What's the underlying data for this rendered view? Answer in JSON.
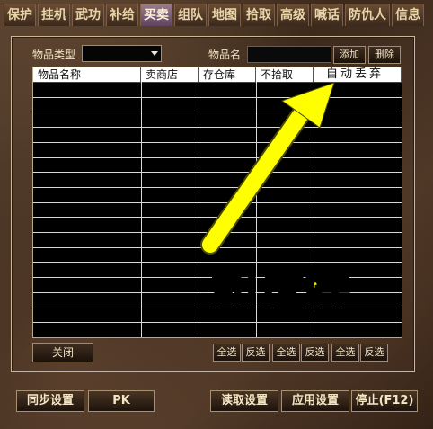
{
  "tabs": [
    {
      "label": "保护"
    },
    {
      "label": "挂机"
    },
    {
      "label": "武功"
    },
    {
      "label": "补给"
    },
    {
      "label": "买卖"
    },
    {
      "label": "组队"
    },
    {
      "label": "地图"
    },
    {
      "label": "拾取"
    },
    {
      "label": "高级"
    },
    {
      "label": "喊话"
    },
    {
      "label": "防仇人"
    },
    {
      "label": "信息"
    }
  ],
  "active_tab": "买卖",
  "filters": {
    "item_type_label": "物品类型",
    "item_type_value": "",
    "item_name_label": "物品名",
    "item_name_value": "",
    "add_label": "添加",
    "delete_label": "删除"
  },
  "table": {
    "columns": [
      "物品名称",
      "卖商店",
      "存仓库",
      "不拾取",
      "自动丢弃"
    ],
    "rows": []
  },
  "panel_buttons": {
    "close_label": "关闭",
    "select_all_label": "全选",
    "invert_label": "反选"
  },
  "footer": {
    "sync_label": "同步设置",
    "pk_label": "PK",
    "load_label": "读取设置",
    "apply_label": "应用设置",
    "stop_label": "停止(F12)"
  },
  "annotation": {
    "text": "如这样",
    "color": "#ffff00"
  }
}
